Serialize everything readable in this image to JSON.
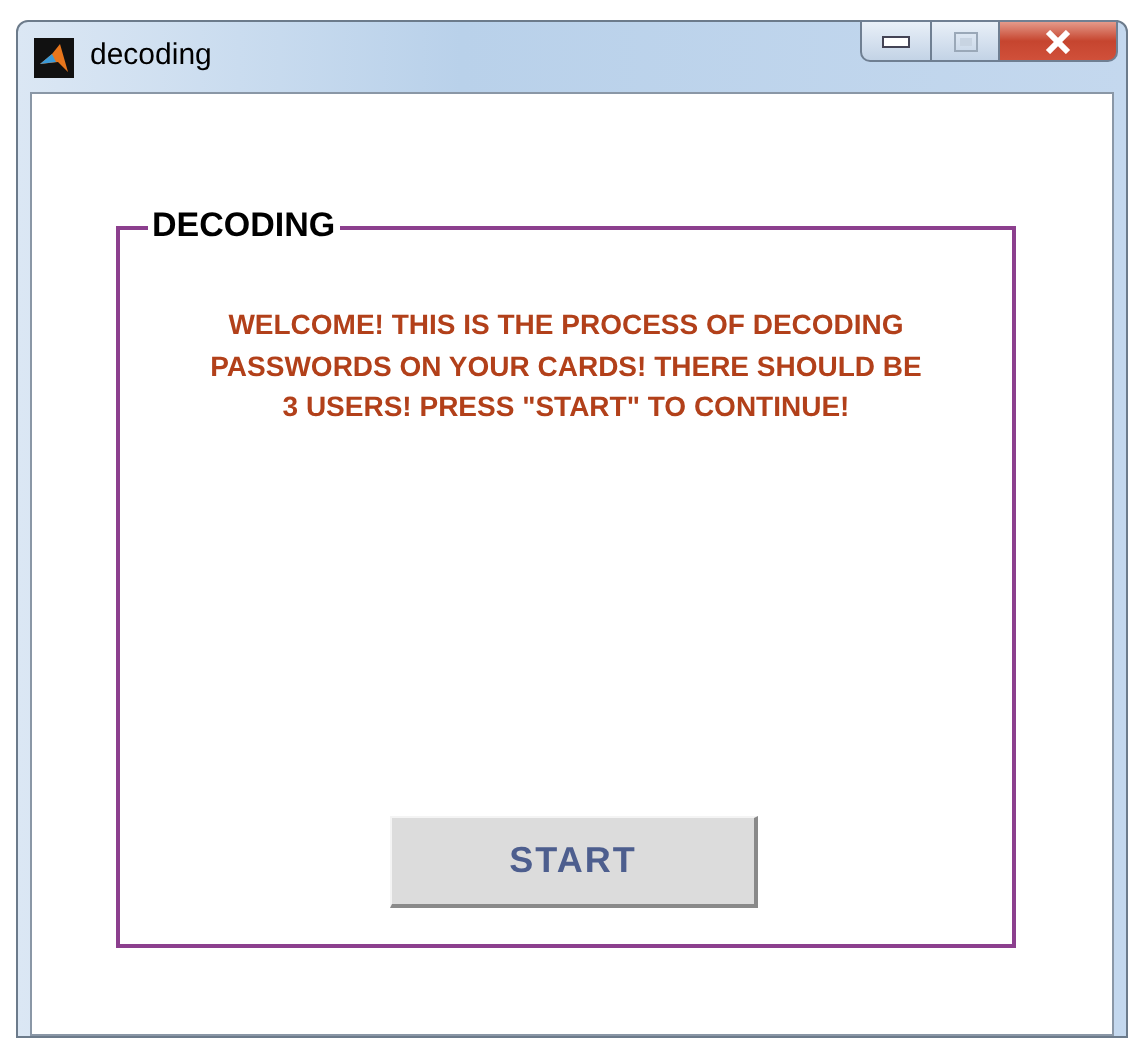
{
  "window": {
    "title": "decoding"
  },
  "panel": {
    "title": "DECODING",
    "message": "WELCOME! THIS IS THE PROCESS OF DECODING PASSWORDS ON YOUR CARDS! THERE SHOULD BE 3 USERS! PRESS \"START\" TO CONTINUE!"
  },
  "buttons": [
    {
      "label": "START"
    }
  ]
}
